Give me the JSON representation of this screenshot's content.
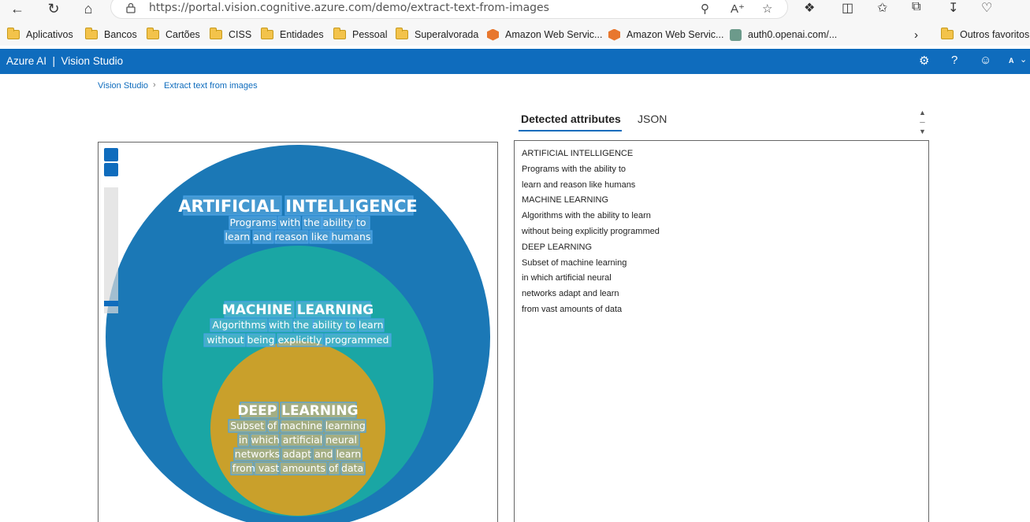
{
  "browser": {
    "url": "https://portal.vision.cognitive.azure.com/demo/extract-text-from-images"
  },
  "bookmarks": [
    {
      "label": "Aplicativos",
      "icon": "folder-icon"
    },
    {
      "label": "Bancos",
      "icon": "folder-icon"
    },
    {
      "label": "Cartões",
      "icon": "folder-icon"
    },
    {
      "label": "CISS",
      "icon": "folder-icon"
    },
    {
      "label": "Entidades",
      "icon": "folder-icon"
    },
    {
      "label": "Pessoal",
      "icon": "folder-icon"
    },
    {
      "label": "Superalvorada",
      "icon": "folder-icon"
    },
    {
      "label": "Amazon Web Servic...",
      "icon": "aws-icon"
    },
    {
      "label": "Amazon Web Servic...",
      "icon": "aws-icon"
    },
    {
      "label": "auth0.openai.com/...",
      "icon": "openai-icon"
    },
    {
      "label": "Outros favoritos",
      "icon": "folder-icon"
    }
  ],
  "header": {
    "title": "Azure AI  |  Vision Studio",
    "user_initial": "A"
  },
  "breadcrumb": {
    "root": "Vision Studio",
    "current": "Extract text from images"
  },
  "image": {
    "outer_title": "ARTIFICIAL INTELLIGENCE",
    "outer_line1": "Programs with the ability to",
    "outer_line2": "learn and reason like humans",
    "middle_title": "MACHINE LEARNING",
    "middle_line1": "Algorithms with the ability to learn",
    "middle_line2": "without being explicitly programmed",
    "inner_title": "DEEP LEARNING",
    "inner_line1": "Subset of machine learning",
    "inner_line2": "in which artificial neural",
    "inner_line3": "networks adapt and learn",
    "inner_line4": "from vast amounts of data",
    "colors": {
      "outer": "#1b78b6",
      "middle": "#1aa6a4",
      "inner": "#c9a02b"
    }
  },
  "tabs": {
    "detected": "Detected attributes",
    "json": "JSON"
  },
  "results": {
    "lines": [
      "ARTIFICIAL INTELLIGENCE",
      "Programs with the ability to",
      "learn and reason like humans",
      "MACHINE LEARNING",
      "Algorithms with the ability to learn",
      "without being explicitly programmed",
      "DEEP LEARNING",
      "Subset of machine learning",
      "in which artificial neural",
      "networks adapt and learn",
      "from vast amounts of data"
    ]
  }
}
